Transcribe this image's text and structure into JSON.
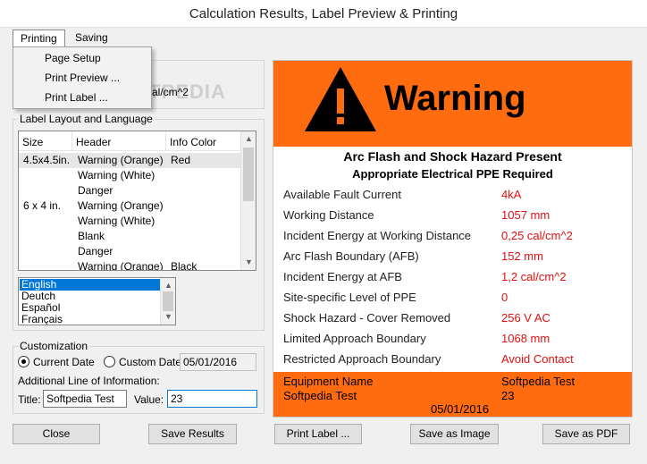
{
  "window": {
    "title": "Calculation Results, Label Preview & Printing"
  },
  "menu": {
    "items": [
      "Printing",
      "Saving"
    ],
    "dropdown": [
      "Page Setup",
      "Print Preview ...",
      "Print Label ..."
    ]
  },
  "behind_menu_text": "al/cm^2",
  "watermark": "SOFTPEDIA",
  "layout": {
    "title": "Label Layout and Language",
    "columns": [
      "Size",
      "Header",
      "Info Color"
    ],
    "rows": [
      {
        "size": "4.5x4.5in.",
        "header": "Warning (Orange)",
        "color": "Red"
      },
      {
        "size": "",
        "header": "Warning (White)",
        "color": ""
      },
      {
        "size": "",
        "header": "Danger",
        "color": ""
      },
      {
        "size": "6 x 4 in.",
        "header": "Warning (Orange)",
        "color": ""
      },
      {
        "size": "",
        "header": "Warning (White)",
        "color": ""
      },
      {
        "size": "",
        "header": "Blank",
        "color": ""
      },
      {
        "size": "",
        "header": "Danger",
        "color": ""
      },
      {
        "size": "",
        "header": "Warning (Orange)",
        "color": "Black"
      }
    ],
    "languages": [
      "English",
      "Deutch",
      "Español",
      "Français"
    ]
  },
  "customization": {
    "title": "Customization",
    "current_date_label": "Current Date",
    "custom_date_label": "Custom Date",
    "custom_date_value": "05/01/2016",
    "additional_line_label": "Additional Line of Information:",
    "title_label": "Title:",
    "title_value": "Softpedia Test",
    "value_label": "Value:",
    "value_value": "23"
  },
  "buttons": {
    "close": "Close",
    "save_results": "Save Results",
    "print_label": "Print Label ...",
    "save_image": "Save as Image",
    "save_pdf": "Save as PDF"
  },
  "label": {
    "warning": "Warning",
    "heading": "Arc Flash and Shock Hazard Present",
    "subheading": "Appropriate Electrical PPE Required",
    "rows": [
      {
        "label": "Available Fault Current",
        "value": "4kA"
      },
      {
        "label": "Working Distance",
        "value": "1057 mm"
      },
      {
        "label": "Incident Energy at Working Distance",
        "value": "0,25 cal/cm^2"
      },
      {
        "label": "Arc Flash Boundary (AFB)",
        "value": "152 mm"
      },
      {
        "label": "Incident Energy at AFB",
        "value": "1,2 cal/cm^2"
      },
      {
        "label": "Site-specific Level of PPE",
        "value": "0"
      },
      {
        "label": "Shock Hazard - Cover Removed",
        "value": "256 V AC"
      },
      {
        "label": "Limited Approach Boundary",
        "value": "1068 mm"
      },
      {
        "label": "Restricted Approach Boundary",
        "value": "Avoid Contact"
      }
    ],
    "footer": {
      "equipment_label": "Equipment Name",
      "equipment_value": "Softpedia Test",
      "title": "Softpedia Test",
      "value": "23",
      "date": "05/01/2016"
    }
  },
  "colors": {
    "orange": "#ff6c10",
    "value_red": "#e01010",
    "selection": "#0078d7"
  }
}
